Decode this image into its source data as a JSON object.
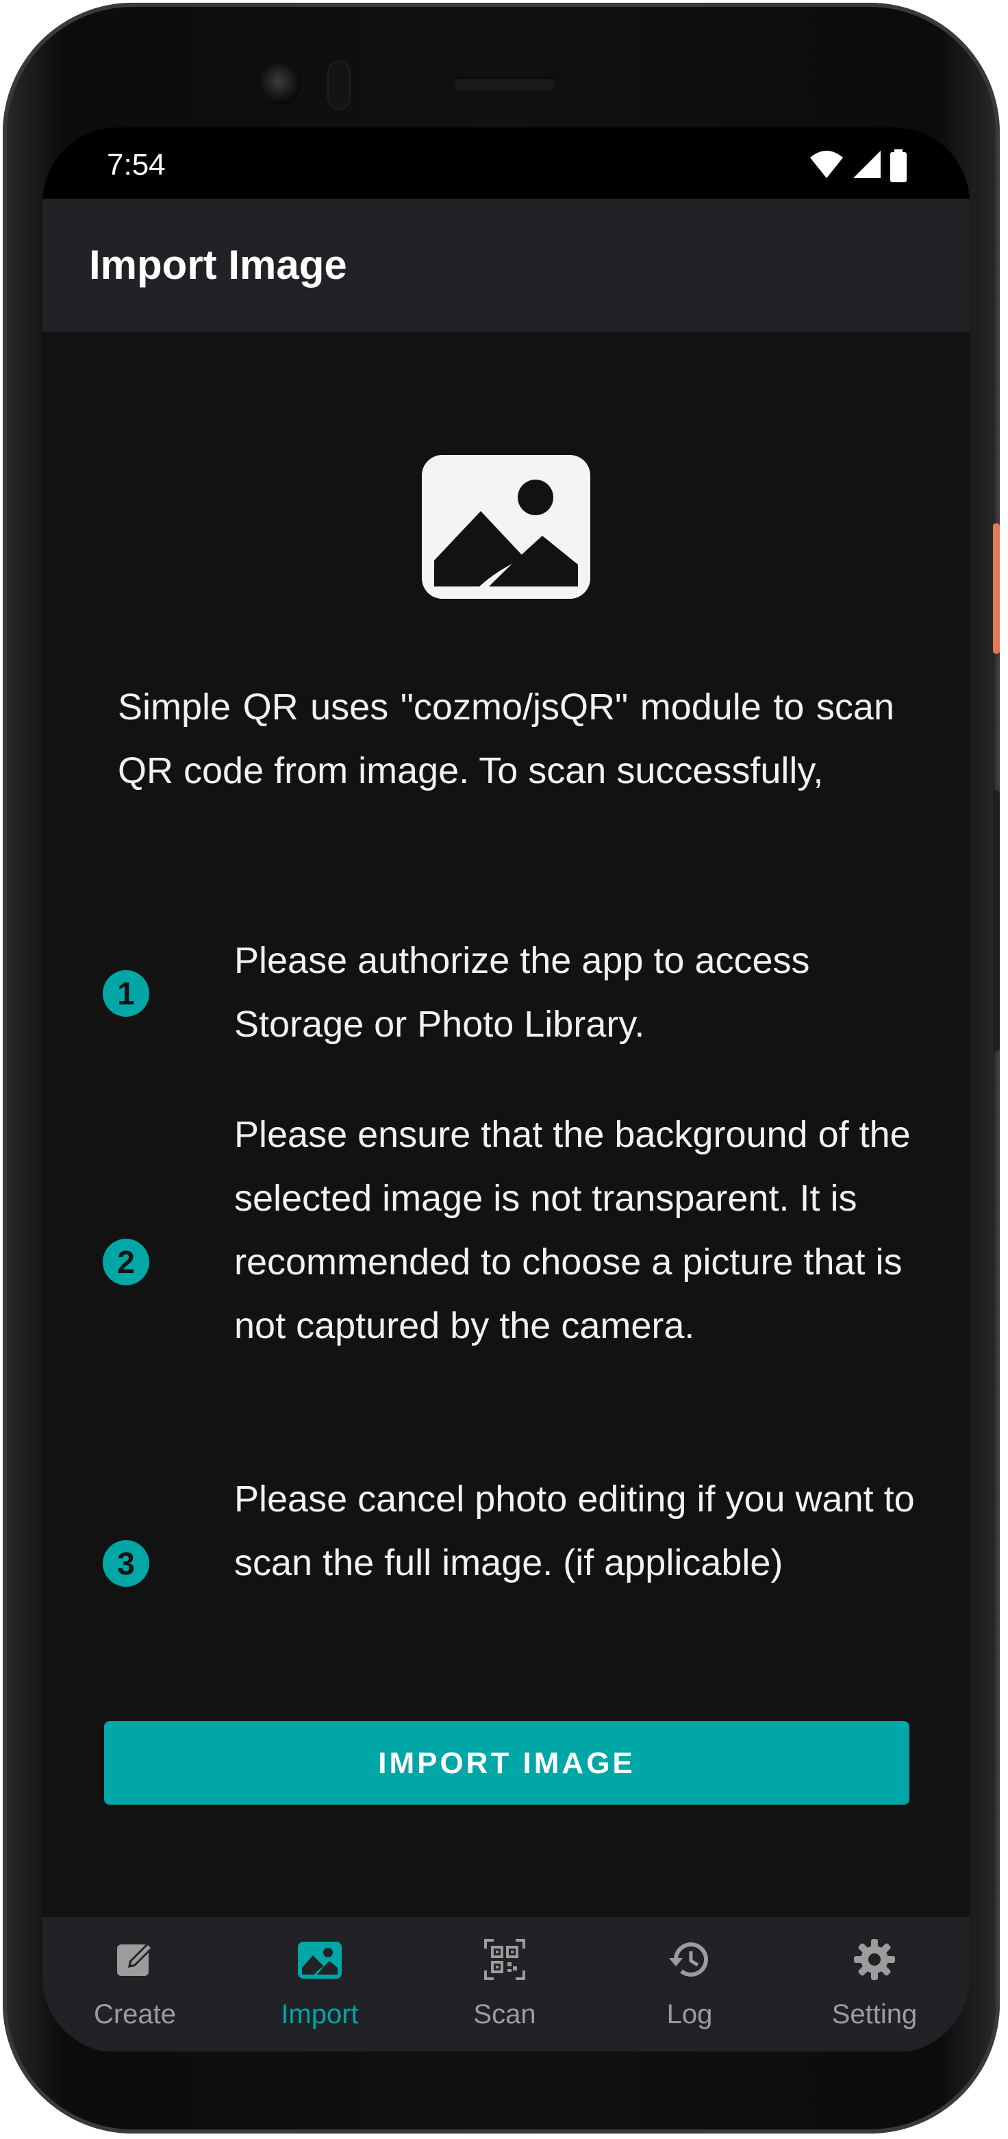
{
  "status_bar": {
    "time": "7:54"
  },
  "app_bar": {
    "title": "Import Image"
  },
  "content": {
    "icon": "image-icon",
    "intro": "Simple QR uses \"cozmo/jsQR\" module to scan QR code from image. To scan successfully,",
    "steps": [
      {
        "number": "1",
        "text": "Please authorize the app to access Storage or Photo Library."
      },
      {
        "number": "2",
        "text": "Please ensure that the background of the selected image is not transparent. It is recommended to choose a picture that is not captured by the camera."
      },
      {
        "number": "3",
        "text": "Please cancel photo editing if you want to scan the full image. (if applicable)"
      }
    ],
    "import_button": "IMPORT IMAGE"
  },
  "bottom_nav": {
    "items": [
      {
        "label": "Create",
        "icon": "edit-icon",
        "active": false
      },
      {
        "label": "Import",
        "icon": "image-icon",
        "active": true
      },
      {
        "label": "Scan",
        "icon": "qr-scan-icon",
        "active": false
      },
      {
        "label": "Log",
        "icon": "history-icon",
        "active": false
      },
      {
        "label": "Setting",
        "icon": "gear-icon",
        "active": false
      }
    ]
  },
  "colors": {
    "accent": "#01a6a6",
    "background": "#121212",
    "bar": "#212225",
    "inactive": "#9c9c9c"
  }
}
